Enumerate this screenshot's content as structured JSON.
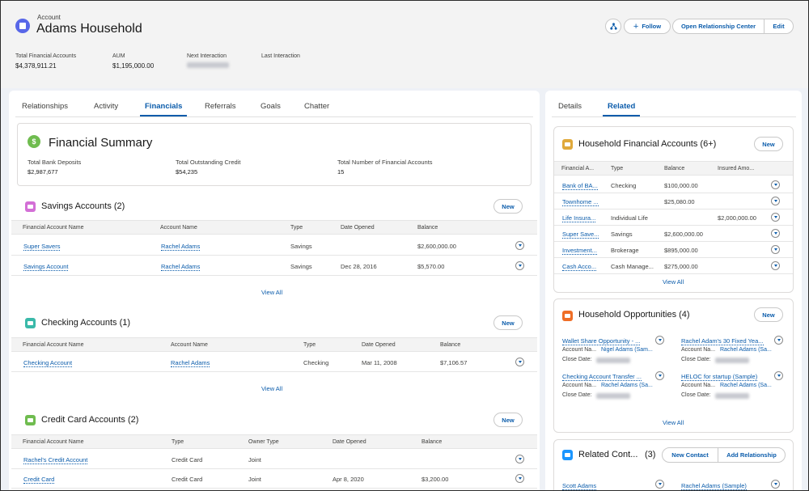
{
  "header": {
    "type_label": "Account",
    "name": "Adams Household",
    "buttons": {
      "follow": "Follow",
      "relationship_center": "Open Relationship Center",
      "edit": "Edit"
    },
    "fields": [
      {
        "label": "Total Financial Accounts",
        "value": "$4,378,911.21"
      },
      {
        "label": "AUM",
        "value": "$1,195,000.00"
      },
      {
        "label": "Next Interaction",
        "value": ""
      },
      {
        "label": "Last Interaction",
        "value": ""
      }
    ]
  },
  "main": {
    "tabs": [
      "Relationships",
      "Activity",
      "Financials",
      "Referrals",
      "Goals",
      "Chatter"
    ],
    "active_tab": "Financials",
    "summary": {
      "title": "Financial Summary",
      "items": [
        {
          "label": "Total Bank Deposits",
          "value": "$2,987,677"
        },
        {
          "label": "Total Outstanding Credit",
          "value": "$54,235"
        },
        {
          "label": "Total Number of Financial Accounts",
          "value": "15"
        }
      ]
    },
    "new_label": "New",
    "view_all": "View All",
    "savings": {
      "title": "Savings Accounts (2)",
      "columns": [
        "Financial Account Name",
        "Account Name",
        "Type",
        "Date Opened",
        "Balance"
      ],
      "rows": [
        [
          "Super Savers",
          "Rachel Adams",
          "Savings",
          "",
          "$2,600,000.00"
        ],
        [
          "Savings Account",
          "Rachel Adams",
          "Savings",
          "Dec 28, 2016",
          "$5,570.00"
        ]
      ]
    },
    "checking": {
      "title": "Checking Accounts (1)",
      "columns": [
        "Financial Account Name",
        "Account Name",
        "Type",
        "Date Opened",
        "Balance"
      ],
      "rows": [
        [
          "Checking Account",
          "Rachel Adams",
          "Checking",
          "Mar 11, 2008",
          "$7,106.57"
        ]
      ]
    },
    "credit": {
      "title": "Credit Card Accounts (2)",
      "columns": [
        "Financial Account Name",
        "Type",
        "Owner Type",
        "Date Opened",
        "Balance"
      ],
      "rows": [
        [
          "Rachel's Credit Account",
          "Credit Card",
          "Joint",
          "",
          ""
        ],
        [
          "Credit Card",
          "Credit Card",
          "Joint",
          "Apr 8, 2020",
          "$3,200.00"
        ]
      ]
    }
  },
  "side": {
    "tabs": [
      "Details",
      "Related"
    ],
    "active_tab": "Related",
    "hfa": {
      "title": "Household Financial Accounts (6+)",
      "columns": [
        "Financial A...",
        "Type",
        "Balance",
        "Insured Amo..."
      ],
      "rows": [
        [
          "Bank of BA...",
          "Checking",
          "$100,000.00",
          ""
        ],
        [
          "Townhome ...",
          "",
          "$25,080.00",
          ""
        ],
        [
          "Life Insura...",
          "Individual Life",
          "",
          "$2,000,000.00"
        ],
        [
          "Super Save...",
          "Savings",
          "$2,600,000.00",
          ""
        ],
        [
          "Investment...",
          "Brokerage",
          "$895,000.00",
          ""
        ],
        [
          "Cash Acco...",
          "Cash Manage...",
          "$275,000.00",
          ""
        ]
      ]
    },
    "opps": {
      "title": "Household Opportunities (4)",
      "acct_label": "Account Na...",
      "close_label": "Close Date:",
      "items": [
        {
          "name": "Wallet Share Opportunity - ...",
          "account": "Nigel Adams (Sam..."
        },
        {
          "name": "Rachel Adam's 30 Fixed Yea...",
          "account": "Rachel Adams (Sa..."
        },
        {
          "name": "Checking Account Transfer ...",
          "account": "Rachel Adams (Sa..."
        },
        {
          "name": "HELOC for startup (Sample)",
          "account": "Rachel Adams (Sa..."
        }
      ]
    },
    "contacts": {
      "title": "Related Cont...",
      "count": "(3)",
      "new_contact": "New Contact",
      "add_relationship": "Add Relationship",
      "items": [
        "Scott Adams",
        "Rachel Adams (Sample)"
      ]
    }
  },
  "colors": {
    "accent": "#0b5cab",
    "account_icon": "#5867e8",
    "savings_icon": "#d36fd6",
    "checking_icon": "#3ab9a9",
    "credit_icon": "#6fbc4f",
    "hfa_icon": "#e0a93b",
    "opps_icon": "#ef6e27",
    "contacts_icon": "#1b96ff"
  }
}
